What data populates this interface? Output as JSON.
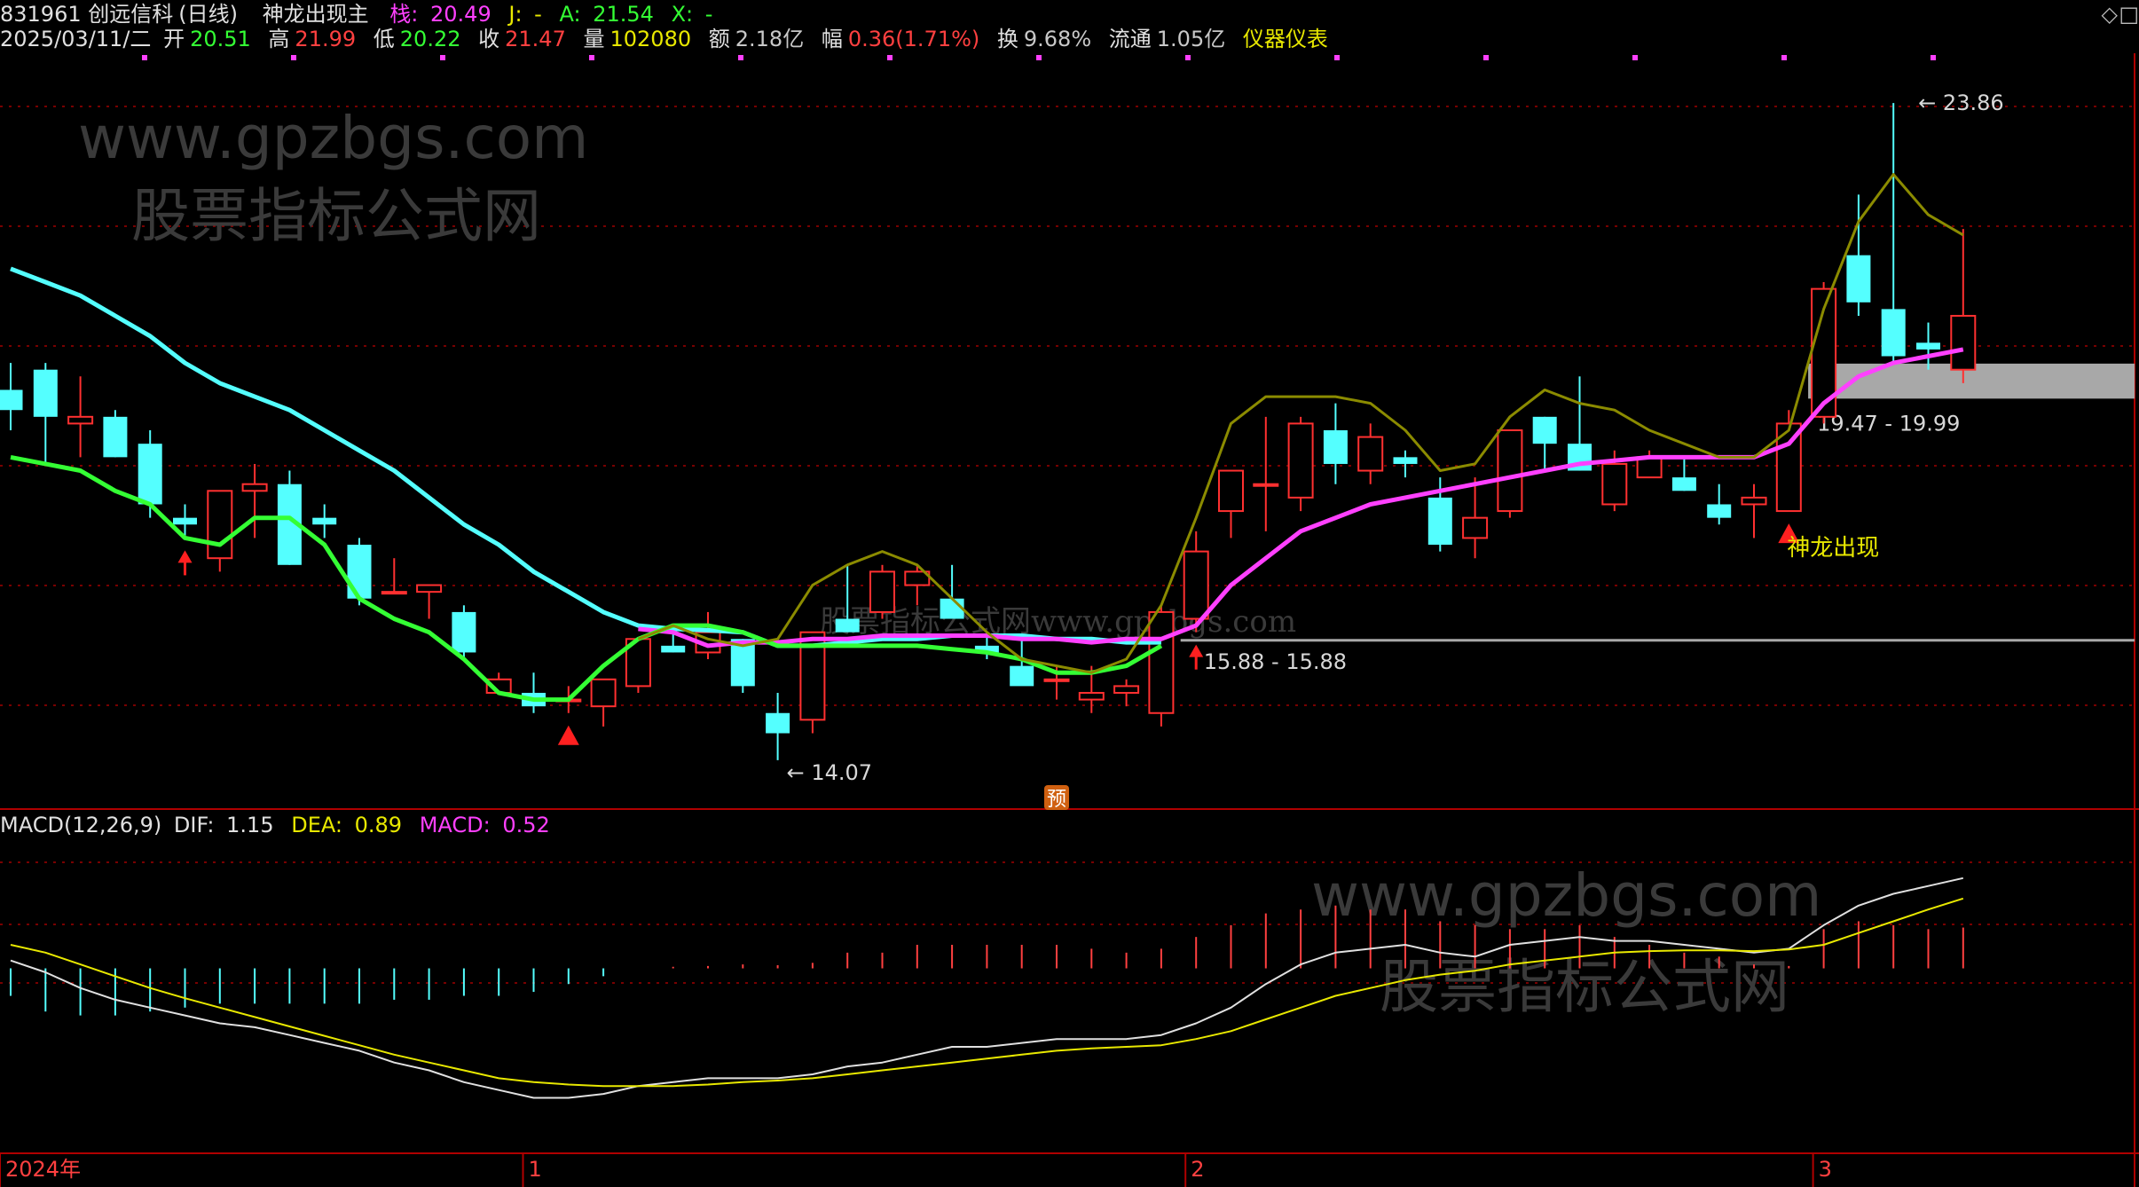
{
  "header": {
    "code_name": "831961 创远信科",
    "period": "(日线)",
    "formula": "神龙出现主",
    "zhan_label": "栈:",
    "zhan_value": "20.49",
    "j_label": "J:",
    "j_value": "-",
    "a_label": "A:",
    "a_value": "21.54",
    "x_label": "X:",
    "x_value": "-",
    "date": "2025/03/11/二",
    "open_label": "开",
    "open": "20.51",
    "high_label": "高",
    "high": "21.99",
    "low_label": "低",
    "low": "20.22",
    "close_label": "收",
    "close": "21.47",
    "vol_label": "量",
    "vol": "102080",
    "amt_label": "额",
    "amt": "2.18亿",
    "chg_label": "幅",
    "chg": "0.36(1.71%)",
    "turn_label": "换",
    "turn": "9.68%",
    "float_label": "流通",
    "float": "1.05亿",
    "industry": "仪器仪表"
  },
  "macd_header": {
    "name": "MACD(12,26,9)",
    "dif_label": "DIF:",
    "dif": "1.15",
    "dea_label": "DEA:",
    "dea": "0.89",
    "macd_label": "MACD:",
    "macd": "0.52"
  },
  "controls": {
    "diamond": "◇",
    "square": "□"
  },
  "chart_data": [
    {
      "type": "candlestick",
      "ylim": [
        13.4,
        24.6
      ],
      "dates_label_ticks": [
        {
          "index": 0,
          "label": "2024年"
        },
        {
          "index": 15,
          "label": "1"
        },
        {
          "index": 34,
          "label": "2"
        },
        {
          "index": 52,
          "label": "3"
        }
      ],
      "ohlc": [
        [
          19.6,
          20.0,
          19.0,
          19.3
        ],
        [
          19.9,
          20.0,
          18.5,
          19.2
        ],
        [
          19.1,
          19.8,
          18.6,
          19.2
        ],
        [
          19.2,
          19.3,
          18.6,
          18.6
        ],
        [
          18.8,
          19.0,
          17.7,
          17.9
        ],
        [
          17.7,
          17.9,
          17.4,
          17.6
        ],
        [
          17.1,
          18.1,
          16.9,
          18.1
        ],
        [
          18.1,
          18.5,
          17.4,
          18.2
        ],
        [
          18.2,
          18.4,
          17.0,
          17.0
        ],
        [
          17.7,
          17.9,
          17.4,
          17.6
        ],
        [
          17.3,
          17.4,
          16.4,
          16.5
        ],
        [
          16.6,
          17.1,
          16.6,
          16.6
        ],
        [
          16.6,
          16.7,
          16.2,
          16.7
        ],
        [
          16.3,
          16.4,
          15.6,
          15.7
        ],
        [
          15.1,
          15.4,
          15.1,
          15.3
        ],
        [
          15.1,
          15.4,
          14.8,
          14.9
        ],
        [
          15.0,
          15.2,
          14.8,
          15.0
        ],
        [
          14.9,
          15.3,
          14.6,
          15.3
        ],
        [
          15.2,
          15.9,
          15.1,
          15.9
        ],
        [
          15.8,
          16.0,
          15.7,
          15.7
        ],
        [
          15.7,
          16.3,
          15.6,
          16.0
        ],
        [
          15.9,
          15.9,
          15.1,
          15.2
        ],
        [
          14.8,
          15.1,
          14.1,
          14.5
        ],
        [
          14.7,
          16.0,
          14.5,
          16.0
        ],
        [
          16.2,
          17.0,
          16.0,
          16.0
        ],
        [
          16.3,
          17.0,
          16.2,
          16.9
        ],
        [
          16.7,
          17.0,
          16.4,
          16.9
        ],
        [
          16.5,
          17.0,
          16.3,
          16.2
        ],
        [
          15.8,
          16.0,
          15.6,
          15.7
        ],
        [
          15.5,
          15.9,
          15.3,
          15.2
        ],
        [
          15.3,
          15.5,
          15.0,
          15.3
        ],
        [
          15.0,
          15.5,
          14.8,
          15.1
        ],
        [
          15.1,
          15.3,
          14.9,
          15.2
        ],
        [
          14.8,
          16.4,
          14.6,
          16.3
        ],
        [
          16.2,
          17.5,
          16.0,
          17.2
        ],
        [
          17.8,
          18.4,
          17.4,
          18.4
        ],
        [
          18.2,
          19.2,
          17.5,
          18.2
        ],
        [
          18.0,
          19.2,
          17.8,
          19.1
        ],
        [
          19.0,
          19.4,
          18.2,
          18.5
        ],
        [
          18.4,
          19.1,
          18.2,
          18.9
        ],
        [
          18.6,
          18.7,
          18.3,
          18.5
        ],
        [
          18.0,
          18.3,
          17.2,
          17.3
        ],
        [
          17.4,
          18.3,
          17.1,
          17.7
        ],
        [
          17.8,
          19.0,
          17.7,
          19.0
        ],
        [
          19.2,
          19.2,
          18.4,
          18.8
        ],
        [
          18.8,
          19.8,
          18.4,
          18.4
        ],
        [
          17.9,
          18.7,
          17.8,
          18.5
        ],
        [
          18.3,
          18.7,
          18.3,
          18.6
        ],
        [
          18.3,
          18.6,
          18.1,
          18.1
        ],
        [
          17.9,
          18.2,
          17.6,
          17.7
        ],
        [
          17.9,
          18.2,
          17.4,
          18.0
        ],
        [
          17.8,
          19.3,
          17.8,
          19.1
        ],
        [
          19.2,
          21.2,
          19.1,
          21.1
        ],
        [
          21.6,
          22.5,
          20.7,
          20.9
        ],
        [
          20.8,
          23.86,
          20.0,
          20.1
        ],
        [
          20.3,
          20.6,
          19.9,
          20.2
        ],
        [
          19.9,
          21.99,
          19.7,
          20.7
        ]
      ],
      "series": [
        {
          "type": "line",
          "color": "#54ffff",
          "values": [
            21.4,
            21.2,
            21.0,
            20.7,
            20.4,
            20.0,
            19.7,
            19.5,
            19.3,
            19.0,
            18.7,
            18.4,
            18.0,
            17.6,
            17.3,
            16.9,
            16.6,
            16.3,
            16.1,
            16.05,
            16.03,
            16.0,
            15.8,
            15.8,
            15.85,
            15.9,
            15.9,
            15.95,
            15.95,
            15.95,
            15.9,
            15.9,
            15.85,
            15.85
          ]
        },
        {
          "type": "line",
          "color": "#ff40ff",
          "values": [
            null,
            null,
            null,
            null,
            null,
            null,
            null,
            null,
            null,
            null,
            null,
            null,
            null,
            null,
            null,
            null,
            null,
            null,
            16.05,
            16.0,
            15.8,
            15.85,
            15.85,
            15.9,
            15.9,
            15.95,
            15.95,
            15.95,
            15.95,
            15.9,
            15.9,
            15.85,
            15.9,
            15.9,
            16.1,
            16.7,
            17.1,
            17.5,
            17.7,
            17.9,
            18.0,
            18.1,
            18.2,
            18.3,
            18.4,
            18.5,
            18.55,
            18.6,
            18.6,
            18.6,
            18.6,
            18.8,
            19.4,
            19.8,
            20.0,
            20.1,
            20.2
          ]
        },
        {
          "type": "line",
          "color": "#34ff34",
          "values": [
            18.6,
            18.5,
            18.4,
            18.1,
            17.9,
            17.4,
            17.3,
            17.7,
            17.7,
            17.3,
            16.5,
            16.2,
            16.0,
            15.6,
            15.1,
            15.0,
            15.0,
            15.5,
            15.9,
            16.1,
            16.1,
            16.0,
            15.8,
            15.8,
            15.8,
            15.8,
            15.8,
            15.75,
            15.7,
            15.6,
            15.4,
            15.4,
            15.5,
            15.8
          ]
        },
        {
          "type": "line",
          "color": "#8b8b00",
          "values": [
            null,
            null,
            null,
            null,
            null,
            null,
            null,
            null,
            null,
            null,
            null,
            null,
            null,
            null,
            null,
            null,
            null,
            null,
            15.9,
            16.1,
            15.9,
            15.8,
            15.9,
            16.7,
            17.0,
            17.2,
            17.0,
            16.5,
            16.0,
            15.6,
            15.5,
            15.4,
            15.6,
            16.4,
            17.7,
            19.1,
            19.5,
            19.5,
            19.5,
            19.4,
            19.0,
            18.4,
            18.5,
            19.2,
            19.6,
            19.4,
            19.3,
            19.0,
            18.8,
            18.6,
            18.6,
            19.0,
            20.8,
            22.1,
            22.8,
            22.2,
            21.9
          ]
        }
      ],
      "markers": [
        {
          "index": 5,
          "type": "arrow-up",
          "color": "#ff2020"
        },
        {
          "index": 16,
          "type": "triangle-up",
          "color": "#ff2020"
        },
        {
          "index": 34,
          "type": "arrow-up",
          "color": "#ff2020"
        },
        {
          "index": 51,
          "type": "triangle-up",
          "color": "#ff2020"
        },
        {
          "index": 30,
          "type": "badge",
          "text": "预"
        }
      ],
      "zones": [
        {
          "low": 19.47,
          "high": 19.99,
          "label": "19.47 - 19.99",
          "from_index": 52
        },
        {
          "low": 15.88,
          "high": 15.88,
          "label": "15.88 - 15.88",
          "from_index": 34
        }
      ],
      "annotations": [
        {
          "text": "23.86",
          "index": 54,
          "value": 23.86
        },
        {
          "text": "14.07",
          "index": 22,
          "value": 14.07
        },
        {
          "text": "神龙出现",
          "index": 51,
          "value": 17.3
        }
      ],
      "watermarks": [
        "www.gpzbgs.com",
        "股票指标公式网",
        "股票指标公式网www.gpzbgs.com"
      ]
    },
    {
      "type": "bar+line",
      "title": "MACD(12,26,9)",
      "ylim": [
        -2.3,
        1.6
      ],
      "series": [
        {
          "name": "DIF",
          "color": "#e0e0e0",
          "values": [
            0.1,
            -0.05,
            -0.25,
            -0.4,
            -0.5,
            -0.6,
            -0.7,
            -0.75,
            -0.85,
            -0.95,
            -1.05,
            -1.2,
            -1.3,
            -1.45,
            -1.55,
            -1.65,
            -1.65,
            -1.6,
            -1.5,
            -1.45,
            -1.4,
            -1.4,
            -1.4,
            -1.35,
            -1.25,
            -1.2,
            -1.1,
            -1.0,
            -1.0,
            -0.95,
            -0.9,
            -0.9,
            -0.9,
            -0.85,
            -0.7,
            -0.5,
            -0.2,
            0.05,
            0.2,
            0.25,
            0.3,
            0.2,
            0.15,
            0.3,
            0.35,
            0.4,
            0.35,
            0.35,
            0.3,
            0.25,
            0.2,
            0.25,
            0.55,
            0.8,
            0.95,
            1.05,
            1.15
          ]
        },
        {
          "name": "DEA",
          "color": "#e8e800",
          "values": [
            0.3,
            0.2,
            0.05,
            -0.1,
            -0.25,
            -0.38,
            -0.5,
            -0.62,
            -0.74,
            -0.86,
            -0.98,
            -1.1,
            -1.2,
            -1.3,
            -1.4,
            -1.45,
            -1.48,
            -1.5,
            -1.5,
            -1.5,
            -1.48,
            -1.45,
            -1.43,
            -1.4,
            -1.35,
            -1.3,
            -1.25,
            -1.2,
            -1.15,
            -1.1,
            -1.05,
            -1.02,
            -1.0,
            -0.98,
            -0.9,
            -0.8,
            -0.65,
            -0.5,
            -0.35,
            -0.25,
            -0.15,
            -0.08,
            -0.03,
            0.05,
            0.1,
            0.15,
            0.2,
            0.22,
            0.23,
            0.23,
            0.22,
            0.24,
            0.3,
            0.45,
            0.6,
            0.75,
            0.89
          ]
        },
        {
          "name": "MACD",
          "color": "#ff4040",
          "values": [
            -0.35,
            -0.55,
            -0.6,
            -0.6,
            -0.55,
            -0.5,
            -0.45,
            -0.45,
            -0.45,
            -0.45,
            -0.45,
            -0.4,
            -0.4,
            -0.35,
            -0.35,
            -0.3,
            -0.2,
            -0.1,
            0.0,
            0.02,
            0.03,
            0.05,
            0.04,
            0.07,
            0.2,
            0.2,
            0.3,
            0.3,
            0.3,
            0.3,
            0.3,
            0.25,
            0.2,
            0.25,
            0.4,
            0.55,
            0.7,
            0.75,
            0.8,
            0.75,
            0.75,
            0.6,
            0.55,
            0.5,
            0.5,
            0.55,
            0.4,
            0.3,
            0.2,
            0.15,
            0.05,
            0.03,
            0.5,
            0.6,
            0.55,
            0.5,
            0.52
          ]
        }
      ]
    }
  ]
}
